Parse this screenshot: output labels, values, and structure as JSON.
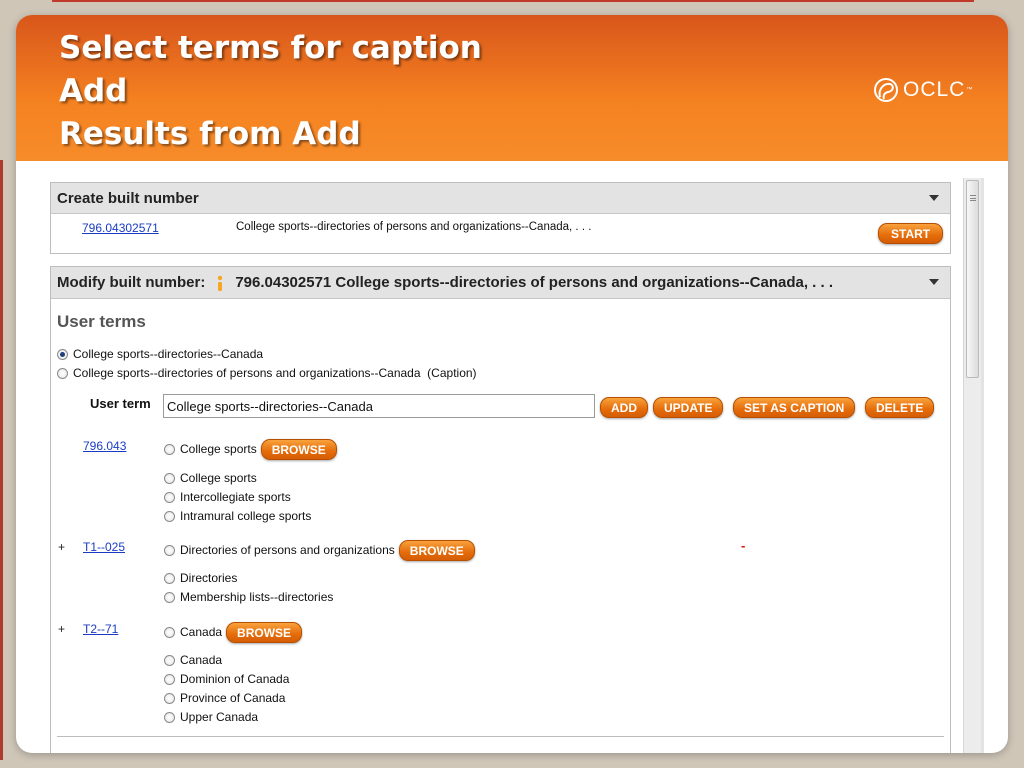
{
  "slide": {
    "title_lines": [
      "Select terms for caption",
      "Add",
      "Results from Add"
    ],
    "logo_text": "OCLC",
    "logo_tm": "™"
  },
  "create_panel": {
    "heading": "Create built number",
    "number": "796.04302571",
    "caption": "College sports--directories of persons and organizations--Canada, . . .",
    "start_label": "START"
  },
  "modify_panel": {
    "heading_prefix": "Modify built number:",
    "heading_value": "796.04302571 College sports--directories of persons and organizations--Canada, . . .",
    "user_terms_title": "User terms",
    "user_term_options": [
      {
        "label": "College sports--directories--Canada",
        "selected": true
      },
      {
        "label": "College sports--directories of persons and organizations--Canada  (Caption)",
        "selected": false
      }
    ],
    "user_term_label": "User term",
    "user_term_value": "College sports--directories--Canada",
    "buttons": {
      "add": "ADD",
      "update": "UPDATE",
      "set_caption": "SET AS CAPTION",
      "delete": "DELETE"
    },
    "browse_label": "BROWSE",
    "groups": [
      {
        "plus": "",
        "number": "796.043",
        "heading_term": "College sports",
        "terms": [
          "College sports",
          "Intercollegiate sports",
          "Intramural college sports"
        ]
      },
      {
        "plus": "+",
        "number": "T1--025",
        "heading_term": "Directories of persons and organizations",
        "marker": "-",
        "terms": [
          "Directories",
          "Membership lists--directories"
        ]
      },
      {
        "plus": "+",
        "number": "T2--71",
        "heading_term": "Canada",
        "terms": [
          "Canada",
          "Dominion of Canada",
          "Province of Canada",
          "Upper Canada"
        ]
      }
    ]
  },
  "colors": {
    "header_orange": "#f58220",
    "button_orange": "#e46c0a",
    "link_blue": "#1a3cc4",
    "marker_red": "#e01010"
  }
}
